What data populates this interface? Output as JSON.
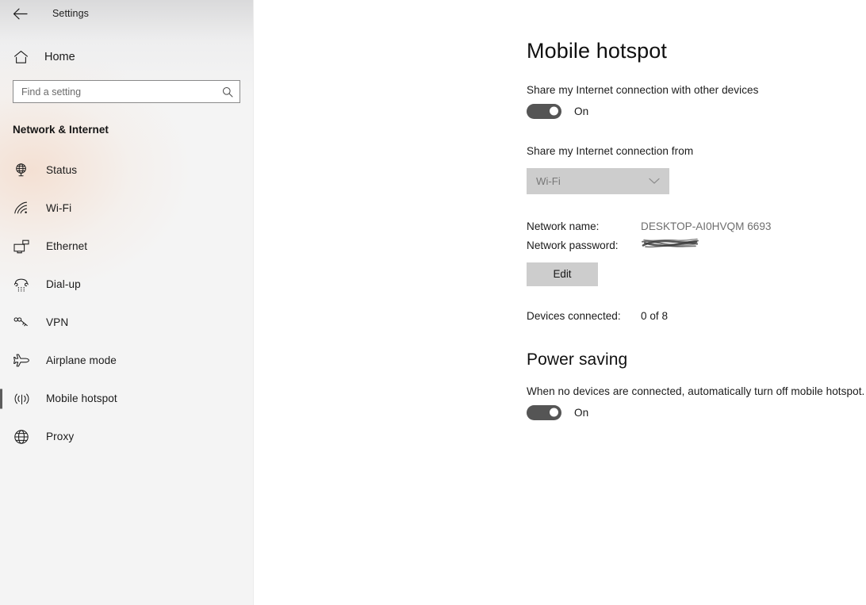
{
  "window": {
    "back_icon": "back-arrow-icon",
    "title": "Settings"
  },
  "sidebar": {
    "home": {
      "label": "Home",
      "icon": "home-icon"
    },
    "search": {
      "placeholder": "Find a setting",
      "value": "",
      "icon": "search-icon"
    },
    "category": "Network & Internet",
    "items": [
      {
        "label": "Status",
        "icon": "status-globe-icon",
        "selected": false
      },
      {
        "label": "Wi-Fi",
        "icon": "wifi-icon",
        "selected": false
      },
      {
        "label": "Ethernet",
        "icon": "ethernet-icon",
        "selected": false
      },
      {
        "label": "Dial-up",
        "icon": "dialup-phone-icon",
        "selected": false
      },
      {
        "label": "VPN",
        "icon": "vpn-key-icon",
        "selected": false
      },
      {
        "label": "Airplane mode",
        "icon": "airplane-icon",
        "selected": false
      },
      {
        "label": "Mobile hotspot",
        "icon": "mobile-hotspot-icon",
        "selected": true
      },
      {
        "label": "Proxy",
        "icon": "proxy-globe-icon",
        "selected": false
      }
    ]
  },
  "main": {
    "page_title": "Mobile hotspot",
    "share": {
      "description": "Share my Internet connection with other devices",
      "toggle_state": "On"
    },
    "share_from": {
      "label": "Share my Internet connection from",
      "selected_option": "Wi-Fi",
      "options": [
        "Wi-Fi"
      ],
      "chevron_icon": "chevron-down-icon"
    },
    "network": {
      "name_label": "Network name:",
      "name_value": "DESKTOP-AI0HVQM 6693",
      "password_label": "Network password:",
      "password_value": "",
      "edit_label": "Edit"
    },
    "devices": {
      "label": "Devices connected:",
      "value": "0 of 8"
    },
    "power_saving": {
      "heading": "Power saving",
      "description": "When no devices are connected, automatically turn off mobile hotspot.",
      "toggle_state": "On"
    }
  },
  "colors": {
    "sidebar_bg": "#f4f4f4",
    "content_bg": "#ffffff",
    "toggle_on": "#555555",
    "control_gray": "#cdcdcd",
    "selection_bar": "#5c5c5c",
    "muted_text": "#6e6e6e"
  }
}
